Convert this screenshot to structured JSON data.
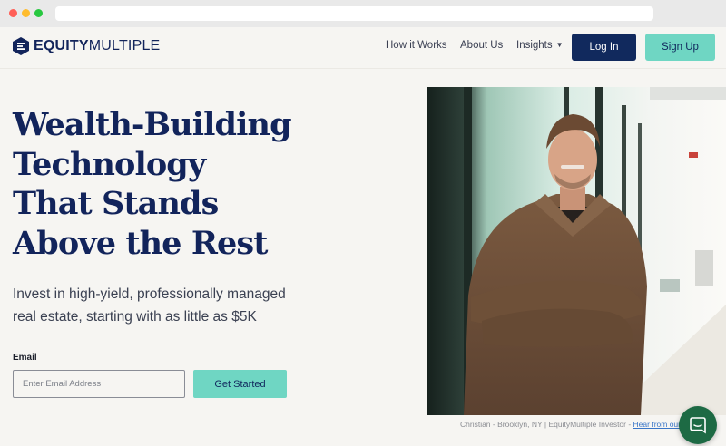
{
  "brand": {
    "logo_bold": "EQUITY",
    "logo_light": "MULTIPLE",
    "navy": "#12245b",
    "mint": "#6fd6c3"
  },
  "nav": {
    "links": [
      "How it Works",
      "About Us",
      "Insights"
    ],
    "login_label": "Log In",
    "signup_label": "Sign Up"
  },
  "hero": {
    "title_lines": [
      "Wealth-Building",
      "Technology",
      "That Stands",
      "Above the Rest"
    ],
    "subtitle": "Invest in high-yield, professionally managed real estate, starting with as little as $5K",
    "email_label": "Email",
    "email_placeholder": "Enter Email Address",
    "email_value": "",
    "cta_label": "Get Started"
  },
  "photo": {
    "caption": "Christian - Brooklyn, NY | EquityMultiple Investor - ",
    "caption_link": "Hear from our"
  },
  "icons": {
    "logo": "equitymultiple-logo-icon",
    "insights_dropdown": "chevron-down-icon",
    "chat": "chat-bubble-icon"
  }
}
